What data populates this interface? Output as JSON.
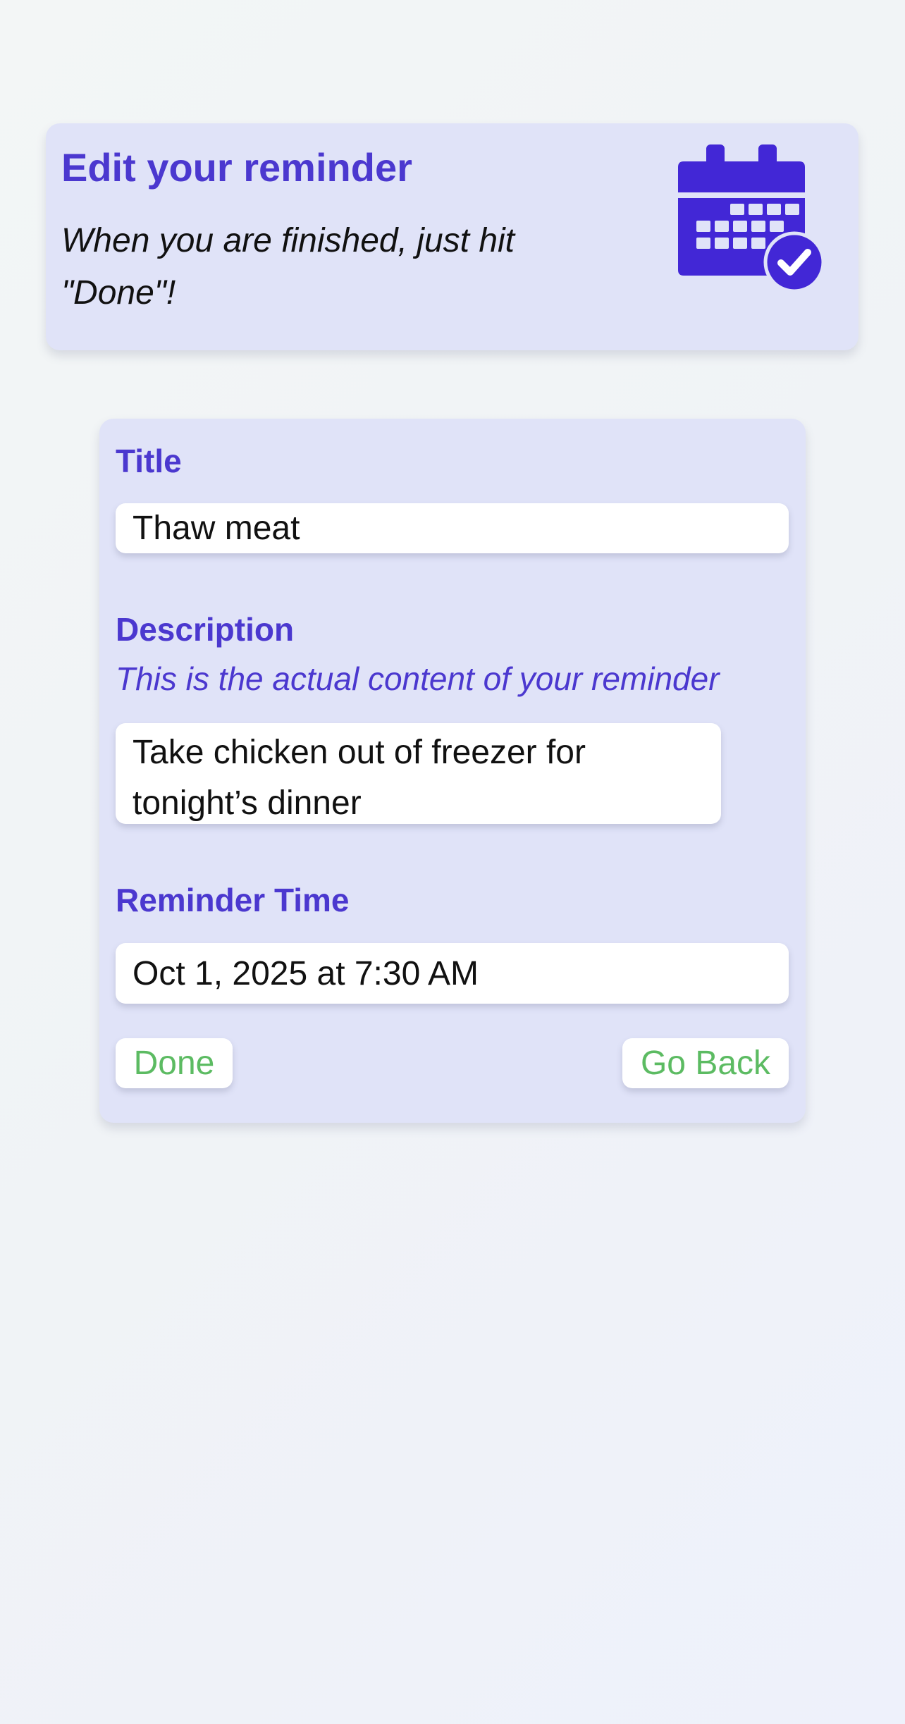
{
  "header": {
    "title": "Edit your reminder",
    "subtitle": "When you are finished, just hit \"Done\"!",
    "icon": "calendar-check-icon"
  },
  "form": {
    "title_label": "Title",
    "title_value": "Thaw meat",
    "description_label": "Description",
    "description_hint": "This is the actual content of your reminder",
    "description_value": "Take chicken out of freezer for tonight’s dinner",
    "time_label": "Reminder Time",
    "time_value": "Oct 1, 2025 at 7:30 AM",
    "done_label": "Done",
    "back_label": "Go Back"
  },
  "colors": {
    "accent": "#4b38cf",
    "card_background": "#e0e3f8",
    "button_text": "#5cbb62",
    "icon": "#4227d6"
  }
}
